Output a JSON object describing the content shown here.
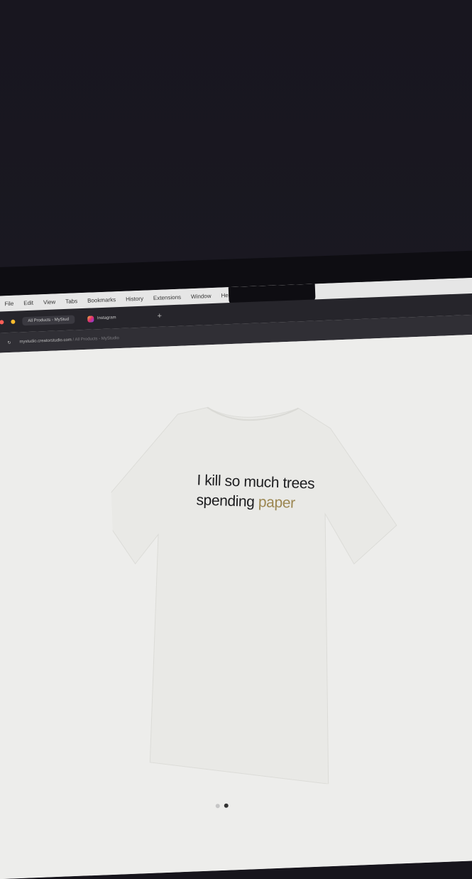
{
  "menu": {
    "items": [
      "File",
      "Edit",
      "View",
      "Tabs",
      "Bookmarks",
      "History",
      "Extensions",
      "Window",
      "Help"
    ]
  },
  "tabs": [
    {
      "label": "All Products - MyStud",
      "active": true
    },
    {
      "label": "Instagram",
      "active": false
    }
  ],
  "new_tab_label": "+",
  "address": {
    "domain": "mystudio.creatorstudio.com",
    "path": "/ All Products - MyStudio"
  },
  "product": {
    "line1": "I kill so much trees",
    "line2_prefix": "spending ",
    "line2_highlight": "paper"
  },
  "carousel": {
    "count": 2,
    "active_index": 1
  },
  "colors": {
    "shirt": "#e9e9e6",
    "page_bg": "#ededeb",
    "highlight_text": "#9c8752"
  }
}
